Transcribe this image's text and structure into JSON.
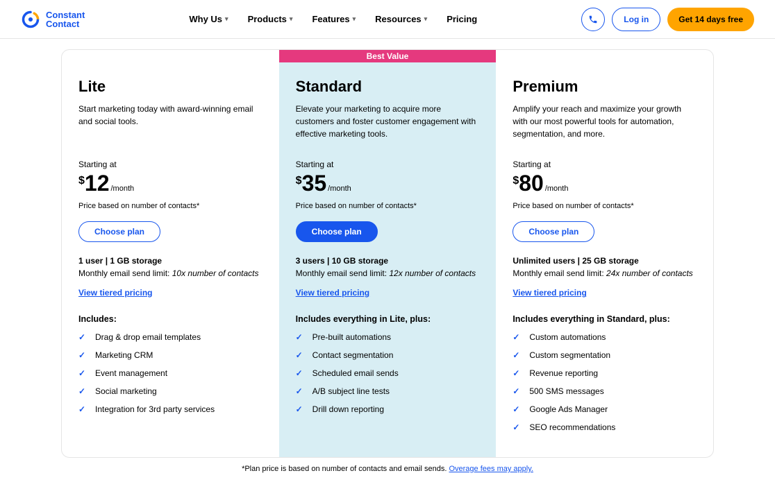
{
  "header": {
    "logo": {
      "line1": "Constant",
      "line2": "Contact"
    },
    "nav": [
      {
        "label": "Why Us",
        "hasDropdown": true
      },
      {
        "label": "Products",
        "hasDropdown": true
      },
      {
        "label": "Features",
        "hasDropdown": true
      },
      {
        "label": "Resources",
        "hasDropdown": true
      },
      {
        "label": "Pricing",
        "hasDropdown": false
      }
    ],
    "login": "Log in",
    "cta": "Get 14 days free"
  },
  "bestValueLabel": "Best Value",
  "plans": [
    {
      "name": "Lite",
      "desc": "Start marketing today with award-winning email and social tools.",
      "starting": "Starting at",
      "currency": "$",
      "price": "12",
      "per": "/month",
      "priceNote": "Price based on number of contacts*",
      "choose": "Choose plan",
      "meta1": "1 user  |  1 GB storage",
      "meta2Prefix": "Monthly email send limit: ",
      "meta2Em": "10x number of contacts",
      "tiered": "View tiered pricing",
      "includesHead": "Includes:",
      "features": [
        "Drag & drop email templates",
        "Marketing CRM",
        "Event management",
        "Social marketing",
        "Integration for 3rd party services"
      ]
    },
    {
      "name": "Standard",
      "desc": "Elevate your marketing to acquire more customers and foster customer engagement with effective marketing tools.",
      "starting": "Starting at",
      "currency": "$",
      "price": "35",
      "per": "/month",
      "priceNote": "Price based on number of contacts*",
      "choose": "Choose plan",
      "meta1": "3 users  |  10 GB storage",
      "meta2Prefix": "Monthly email send limit: ",
      "meta2Em": "12x number of contacts",
      "tiered": "View tiered pricing",
      "includesHead": "Includes everything in Lite, plus:",
      "features": [
        "Pre-built automations",
        "Contact segmentation",
        "Scheduled email sends",
        "A/B subject line tests",
        "Drill down reporting"
      ]
    },
    {
      "name": "Premium",
      "desc": "Amplify your reach and maximize your growth with our most powerful tools for automation, segmentation, and more.",
      "starting": "Starting at",
      "currency": "$",
      "price": "80",
      "per": "/month",
      "priceNote": "Price based on number of contacts*",
      "choose": "Choose plan",
      "meta1": "Unlimited users  |  25  GB storage",
      "meta2Prefix": "Monthly email send limit: ",
      "meta2Em": "24x number of contacts",
      "tiered": "View tiered pricing",
      "includesHead": "Includes everything in Standard, plus:",
      "features": [
        "Custom automations",
        "Custom segmentation",
        "Revenue reporting",
        "500 SMS messages",
        "Google Ads Manager",
        "SEO recommendations"
      ]
    }
  ],
  "footnote": {
    "text": "*Plan price is based on number of contacts and email sends. ",
    "link": "Overage fees may apply."
  }
}
